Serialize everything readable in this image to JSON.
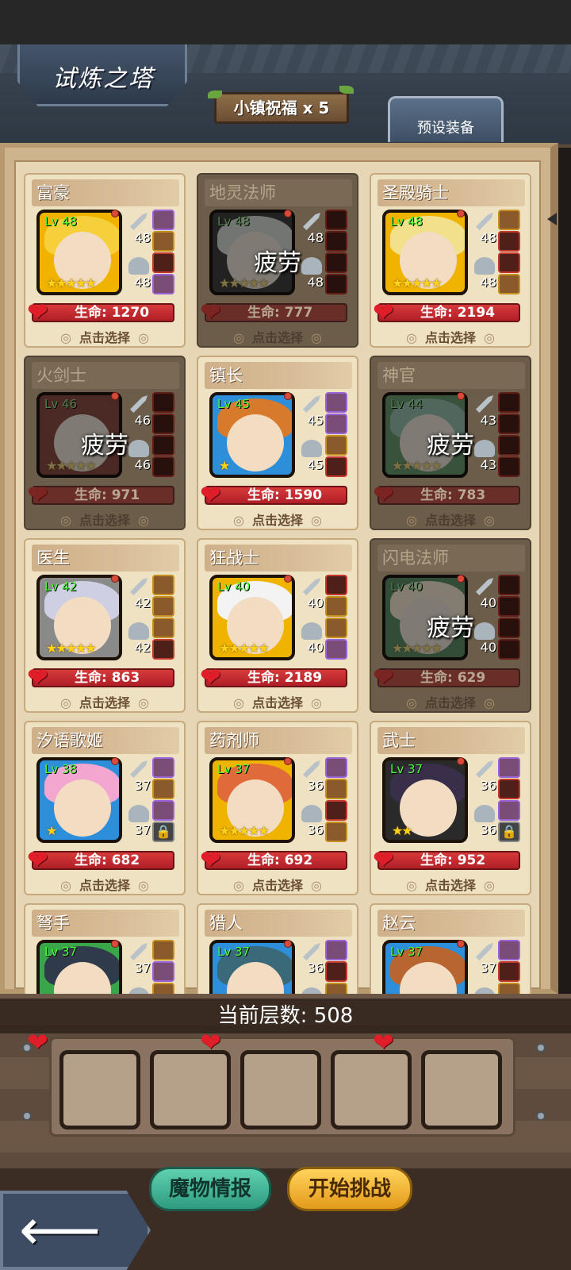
{
  "header": {
    "title": "试炼之塔",
    "blessing": "小镇祝福 x 5",
    "preset_button": "预设装备"
  },
  "labels": {
    "hp_prefix": "生命:",
    "select": "点击选择",
    "tired": "疲劳"
  },
  "heroes": [
    {
      "name": "富豪",
      "level_text": "Lv 48",
      "weapon_lv": "48",
      "armor_lv": "48",
      "hp": "生命: 1270",
      "stars": 5,
      "tired": false
    },
    {
      "name": "地灵法师",
      "level_text": "Lv 48",
      "weapon_lv": "48",
      "armor_lv": "48",
      "hp": "生命: 777",
      "stars": 5,
      "tired": true
    },
    {
      "name": "圣殿骑士",
      "level_text": "Lv 48",
      "weapon_lv": "48",
      "armor_lv": "48",
      "hp": "生命: 2194",
      "stars": 5,
      "tired": false
    },
    {
      "name": "火剑士",
      "level_text": "Lv 46",
      "weapon_lv": "46",
      "armor_lv": "46",
      "hp": "生命: 971",
      "stars": 5,
      "tired": true
    },
    {
      "name": "镇长",
      "level_text": "Lv 45",
      "weapon_lv": "45",
      "armor_lv": "45",
      "hp": "生命: 1590",
      "stars": 1,
      "tired": false
    },
    {
      "name": "神官",
      "level_text": "Lv 44",
      "weapon_lv": "43",
      "armor_lv": "43",
      "hp": "生命: 783",
      "stars": 5,
      "tired": true
    },
    {
      "name": "医生",
      "level_text": "Lv 42",
      "weapon_lv": "42",
      "armor_lv": "42",
      "hp": "生命: 863",
      "stars": 5,
      "tired": false
    },
    {
      "name": "狂战士",
      "level_text": "Lv 40",
      "weapon_lv": "40",
      "armor_lv": "40",
      "hp": "生命: 2189",
      "stars": 5,
      "tired": false
    },
    {
      "name": "闪电法师",
      "level_text": "Lv 40",
      "weapon_lv": "40",
      "armor_lv": "40",
      "hp": "生命: 629",
      "stars": 5,
      "tired": true
    },
    {
      "name": "汐语歌姬",
      "level_text": "Lv 38",
      "weapon_lv": "37",
      "armor_lv": "37",
      "hp": "生命: 682",
      "stars": 1,
      "tired": false
    },
    {
      "name": "药剂师",
      "level_text": "Lv 37",
      "weapon_lv": "36",
      "armor_lv": "36",
      "hp": "生命: 692",
      "stars": 5,
      "tired": false
    },
    {
      "name": "武士",
      "level_text": "Lv 37",
      "weapon_lv": "36",
      "armor_lv": "36",
      "hp": "生命: 952",
      "stars": 2,
      "tired": false
    },
    {
      "name": "弩手",
      "level_text": "Lv 37",
      "weapon_lv": "37",
      "armor_lv": "",
      "hp": "",
      "stars": 0,
      "tired": false
    },
    {
      "name": "猎人",
      "level_text": "Lv 37",
      "weapon_lv": "36",
      "armor_lv": "",
      "hp": "",
      "stars": 0,
      "tired": false
    },
    {
      "name": "赵云",
      "level_text": "Lv 37",
      "weapon_lv": "37",
      "armor_lv": "",
      "hp": "",
      "stars": 0,
      "tired": false
    }
  ],
  "footer": {
    "floor_label": "当前层数: 508",
    "team_slot_count": 5,
    "monster_info_button": "魔物情报",
    "start_button": "开始挑战"
  },
  "icons": {
    "back": "back-arrow-icon",
    "heart": "heart-icon",
    "sword": "sword-icon",
    "helmet": "helmet-icon",
    "lock": "lock-icon"
  },
  "colors": {
    "hp_bar": "#d63a3a",
    "level_text": "#4dff3a",
    "star": "#ffd21a",
    "start_button": "#ffd35c",
    "monster_button": "#5fd1b0"
  }
}
